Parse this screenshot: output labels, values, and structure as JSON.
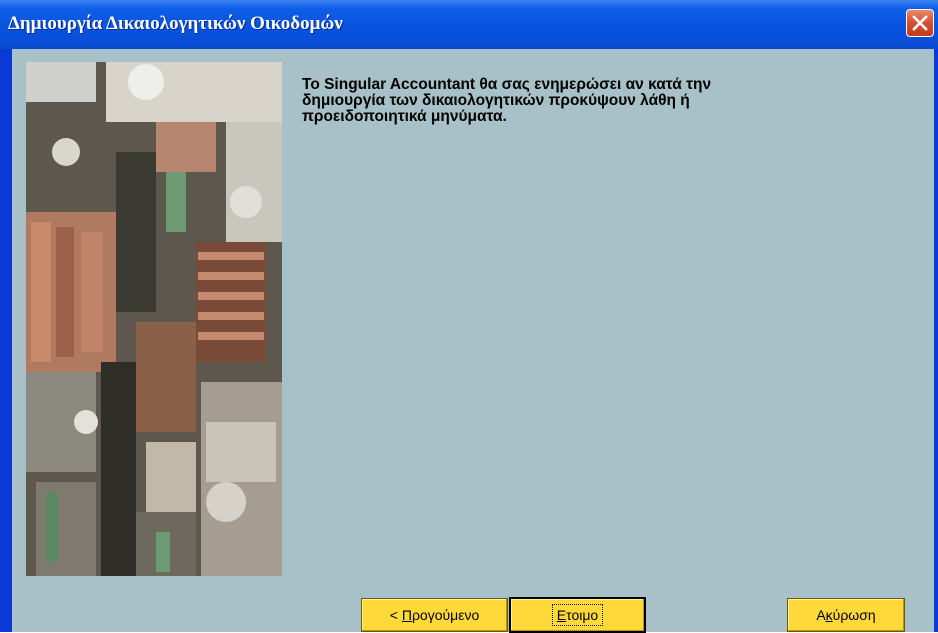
{
  "window": {
    "title": "Δημιουργία Δικαιολογητικών Οικοδομών"
  },
  "message": {
    "line1": "To Singular Accountant θα σας ενημερώσει αν κατά την",
    "line2": "δημιουργία των δικαιολογητικών  προκύψουν λάθη ή",
    "line3": "προειδοποιητικά μηνύματα."
  },
  "buttons": {
    "back": {
      "prefix": "< ",
      "mnemonic": "Π",
      "rest": "ρογούμενο"
    },
    "finish": {
      "mnemonic": "Ε",
      "rest": "τοιμο"
    },
    "cancel": {
      "prefix": "Α",
      "mnemonic": "κ",
      "rest": "ύρωση"
    }
  },
  "icons": {
    "close": "close-icon",
    "side_image": "abstract-painting-image"
  },
  "colors": {
    "titlebar": "#0852de",
    "client_bg": "#a8c0c7",
    "button_bg": "#ffd83a",
    "close_bg": "#d3502f"
  }
}
